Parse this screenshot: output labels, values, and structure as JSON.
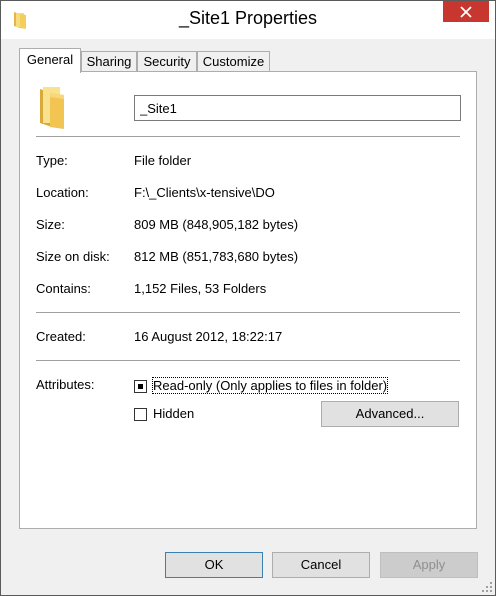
{
  "window": {
    "title": "_Site1 Properties"
  },
  "tabs": [
    {
      "label": "General"
    },
    {
      "label": "Sharing"
    },
    {
      "label": "Security"
    },
    {
      "label": "Customize"
    }
  ],
  "general": {
    "name_value": "_Site1",
    "fields": [
      {
        "label": "Type:",
        "value": "File folder"
      },
      {
        "label": "Location:",
        "value": "F:\\_Clients\\x-tensive\\DO"
      },
      {
        "label": "Size:",
        "value": "809 MB (848,905,182 bytes)"
      },
      {
        "label": "Size on disk:",
        "value": "812 MB (851,783,680 bytes)"
      },
      {
        "label": "Contains:",
        "value": "1,152 Files, 53 Folders"
      }
    ],
    "created": {
      "label": "Created:",
      "value": "16 August 2012, 18:22:17"
    },
    "attributes": {
      "label": "Attributes:",
      "readonly_label": "Read-only (Only applies to files in folder)",
      "readonly_state": "indeterminate",
      "hidden_label": "Hidden",
      "hidden_state": "unchecked",
      "advanced_label": "Advanced..."
    }
  },
  "footer": {
    "ok_label": "OK",
    "cancel_label": "Cancel",
    "apply_label": "Apply"
  },
  "icons": {
    "title": "folder-icon",
    "close": "close-icon",
    "folder": "folder-icon"
  },
  "colors": {
    "close_button": "#c7372f",
    "window_bg": "#f0f0f0",
    "folder_yellow": "#f6d36b"
  }
}
